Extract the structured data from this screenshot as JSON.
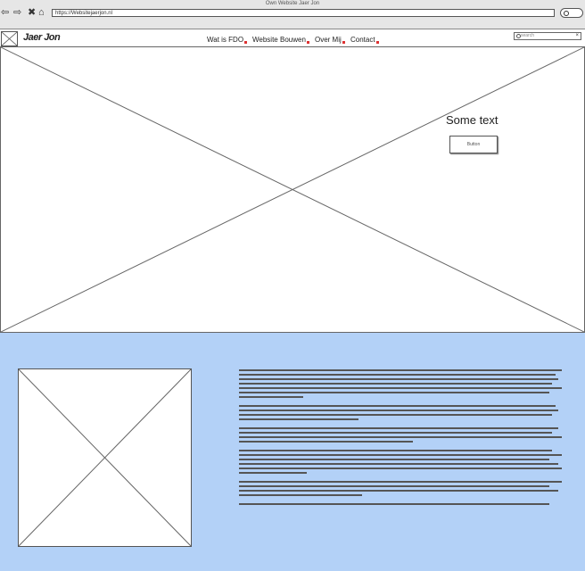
{
  "browser": {
    "window_title": "Own Website Jaer Jon",
    "url": "https://Websitejaerjon.nl",
    "nav_icons": [
      "back-icon",
      "forward-icon",
      "stop-icon",
      "home-icon"
    ]
  },
  "site": {
    "logo_text": "Jaer Jon",
    "nav": [
      {
        "label": "Wat is FDO"
      },
      {
        "label": "Website Bouwen"
      },
      {
        "label": "Over Mij"
      },
      {
        "label": "Contact"
      }
    ],
    "search_placeholder": "search",
    "search_clear": "×"
  },
  "hero": {
    "text": "Some text",
    "button_label": "Button"
  },
  "content": {
    "paragraph_line_counts": [
      7,
      4,
      4,
      6,
      4,
      1
    ]
  },
  "colors": {
    "page_background": "#b3d1f7",
    "wireframe_stroke": "#666666"
  }
}
